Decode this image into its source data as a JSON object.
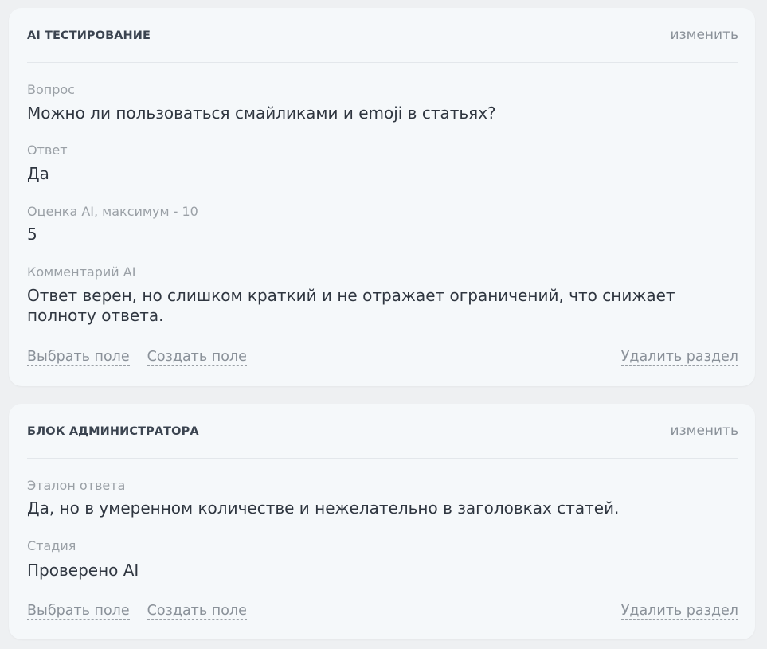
{
  "sections": [
    {
      "title": "AI ТЕСТИРОВАНИЕ",
      "edit_label": "изменить",
      "fields": [
        {
          "label": "Вопрос",
          "value": "Можно ли пользоваться смайликами и emoji в статьях?"
        },
        {
          "label": "Ответ",
          "value": "Да"
        },
        {
          "label": "Оценка AI, максимум - 10",
          "value": "5"
        },
        {
          "label": "Комментарий AI",
          "value": "Ответ верен, но слишком краткий и не отражает ограничений, что снижает полноту ответа."
        }
      ],
      "actions": {
        "select_field": "Выбрать поле",
        "create_field": "Создать поле",
        "delete_section": "Удалить раздел"
      }
    },
    {
      "title": "БЛОК АДМИНИСТРАТОРА",
      "edit_label": "изменить",
      "fields": [
        {
          "label": "Эталон ответа",
          "value": "Да, но в умеренном количестве и нежелательно в заголовках статей."
        },
        {
          "label": "Стадия",
          "value": "Проверено AI"
        }
      ],
      "actions": {
        "select_field": "Выбрать поле",
        "create_field": "Создать поле",
        "delete_section": "Удалить раздел"
      }
    }
  ]
}
